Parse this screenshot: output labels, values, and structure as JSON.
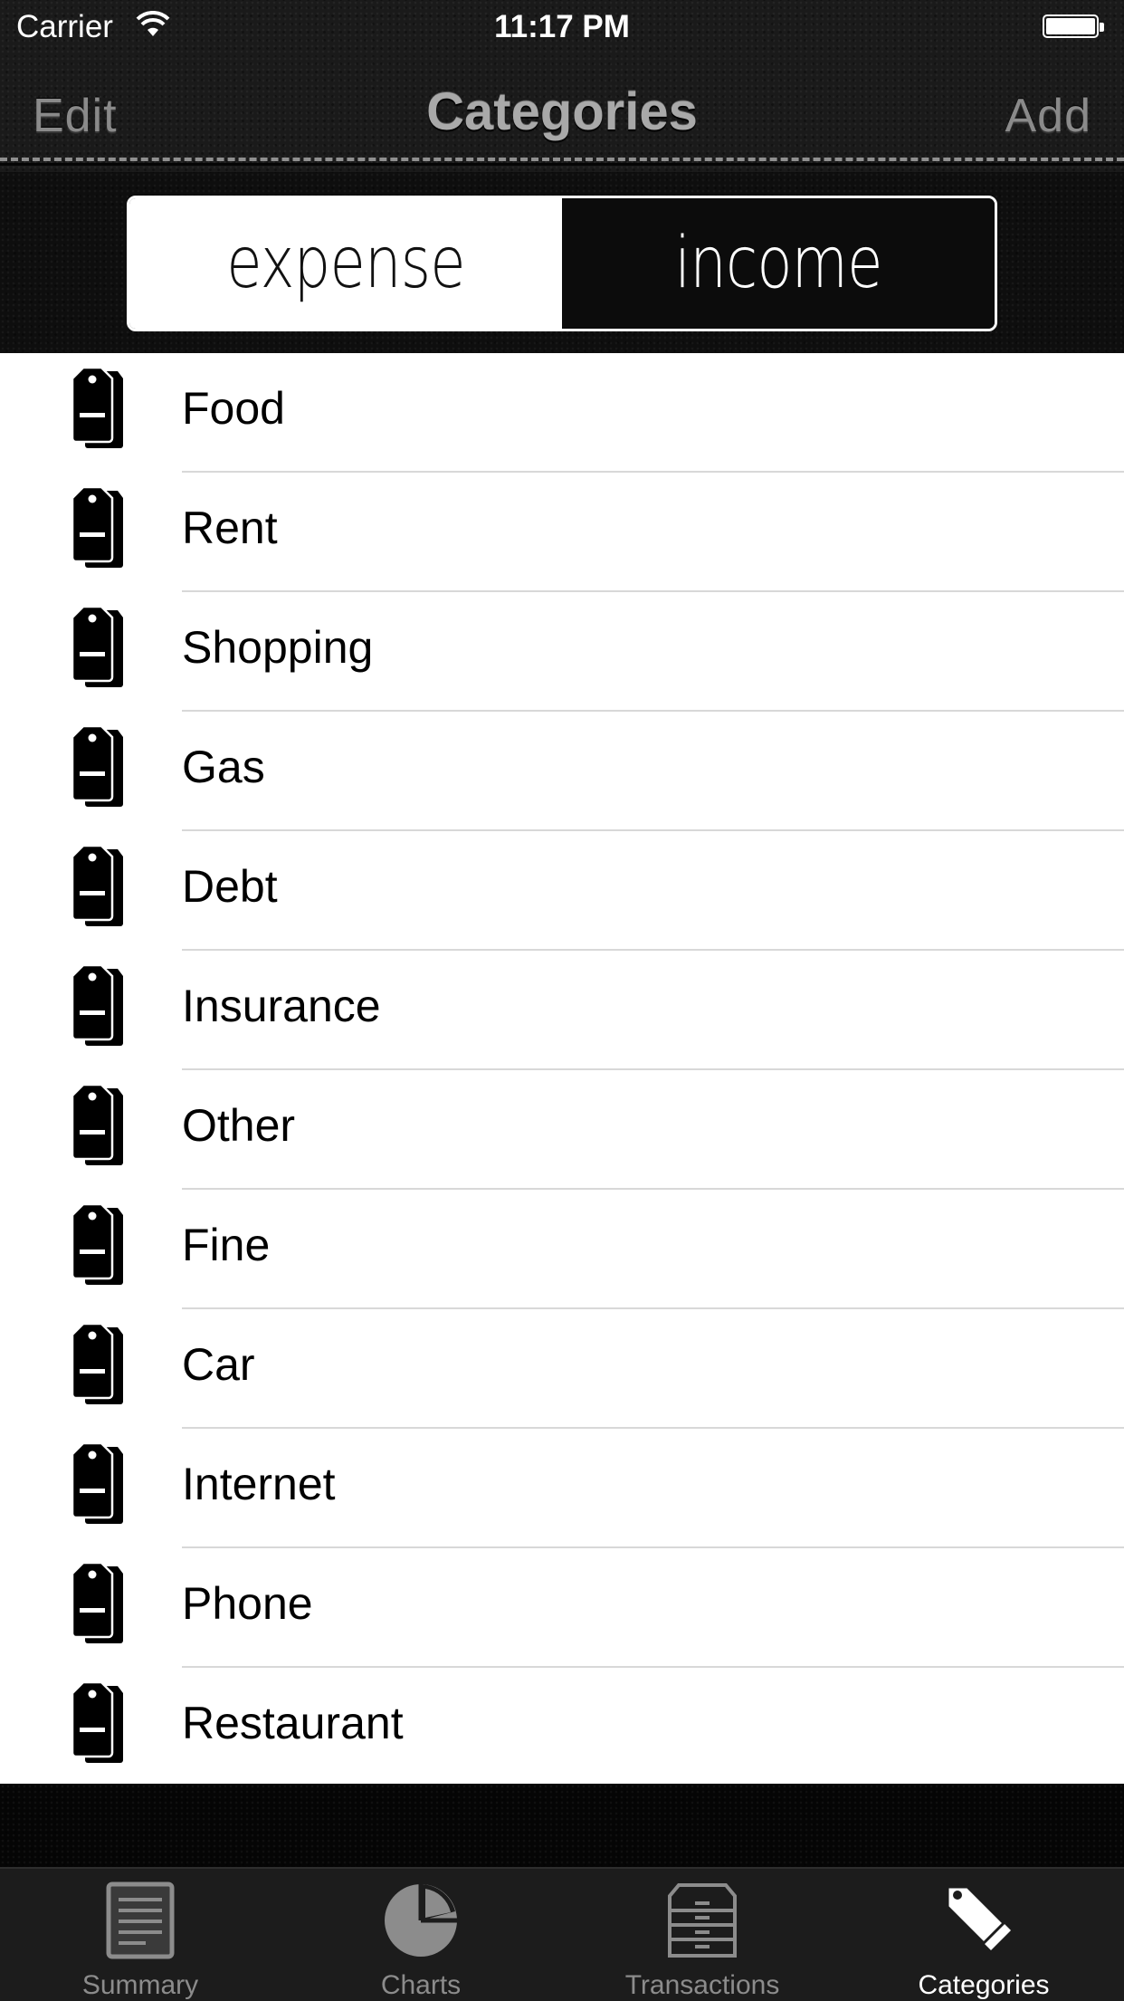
{
  "status_bar": {
    "carrier": "Carrier",
    "time": "11:17 PM",
    "wifi_icon": "wifi-icon",
    "battery_icon": "battery-full-icon"
  },
  "navbar": {
    "edit_label": "Edit",
    "title": "Categories",
    "add_label": "Add"
  },
  "segmented": {
    "options": [
      {
        "label": "expense",
        "selected": true
      },
      {
        "label": "income",
        "selected": false
      }
    ]
  },
  "categories": {
    "icon": "price-tag-icon",
    "items": [
      {
        "label": "Food"
      },
      {
        "label": "Rent"
      },
      {
        "label": "Shopping"
      },
      {
        "label": "Gas"
      },
      {
        "label": "Debt"
      },
      {
        "label": "Insurance"
      },
      {
        "label": "Other"
      },
      {
        "label": "Fine"
      },
      {
        "label": "Car"
      },
      {
        "label": "Internet"
      },
      {
        "label": "Phone"
      },
      {
        "label": "Restaurant"
      }
    ]
  },
  "tabbar": {
    "tabs": [
      {
        "label": "Summary",
        "icon": "document-icon",
        "active": false
      },
      {
        "label": "Charts",
        "icon": "pie-chart-icon",
        "active": false
      },
      {
        "label": "Transactions",
        "icon": "drawer-cabinet-icon",
        "active": false
      },
      {
        "label": "Categories",
        "icon": "tags-icon",
        "active": true
      }
    ]
  },
  "colors": {
    "background_dark": "#1a1a1a",
    "nav_text": "#8a8a8a",
    "title_text": "#a9a9a9",
    "list_background": "#ffffff",
    "separator": "#d8d8d8",
    "tab_inactive": "#8c8c8c",
    "tab_active": "#ffffff"
  }
}
